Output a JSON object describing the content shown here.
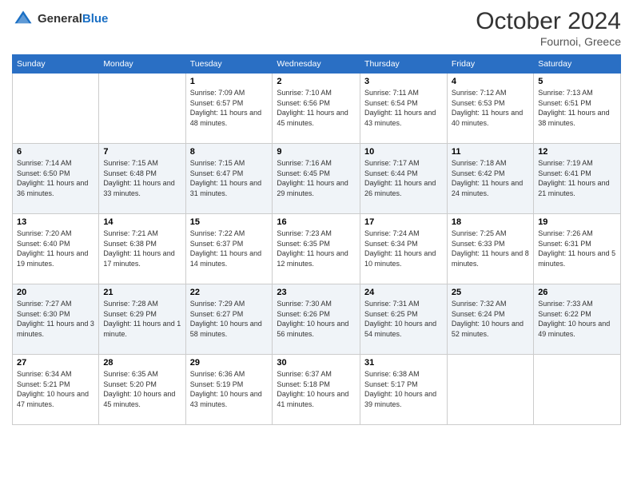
{
  "header": {
    "logo_general": "General",
    "logo_blue": "Blue",
    "month": "October 2024",
    "location": "Fournoi, Greece"
  },
  "weekdays": [
    "Sunday",
    "Monday",
    "Tuesday",
    "Wednesday",
    "Thursday",
    "Friday",
    "Saturday"
  ],
  "weeks": [
    [
      {
        "date": "",
        "info": ""
      },
      {
        "date": "",
        "info": ""
      },
      {
        "date": "1",
        "info": "Sunrise: 7:09 AM\nSunset: 6:57 PM\nDaylight: 11 hours and 48 minutes."
      },
      {
        "date": "2",
        "info": "Sunrise: 7:10 AM\nSunset: 6:56 PM\nDaylight: 11 hours and 45 minutes."
      },
      {
        "date": "3",
        "info": "Sunrise: 7:11 AM\nSunset: 6:54 PM\nDaylight: 11 hours and 43 minutes."
      },
      {
        "date": "4",
        "info": "Sunrise: 7:12 AM\nSunset: 6:53 PM\nDaylight: 11 hours and 40 minutes."
      },
      {
        "date": "5",
        "info": "Sunrise: 7:13 AM\nSunset: 6:51 PM\nDaylight: 11 hours and 38 minutes."
      }
    ],
    [
      {
        "date": "6",
        "info": "Sunrise: 7:14 AM\nSunset: 6:50 PM\nDaylight: 11 hours and 36 minutes."
      },
      {
        "date": "7",
        "info": "Sunrise: 7:15 AM\nSunset: 6:48 PM\nDaylight: 11 hours and 33 minutes."
      },
      {
        "date": "8",
        "info": "Sunrise: 7:15 AM\nSunset: 6:47 PM\nDaylight: 11 hours and 31 minutes."
      },
      {
        "date": "9",
        "info": "Sunrise: 7:16 AM\nSunset: 6:45 PM\nDaylight: 11 hours and 29 minutes."
      },
      {
        "date": "10",
        "info": "Sunrise: 7:17 AM\nSunset: 6:44 PM\nDaylight: 11 hours and 26 minutes."
      },
      {
        "date": "11",
        "info": "Sunrise: 7:18 AM\nSunset: 6:42 PM\nDaylight: 11 hours and 24 minutes."
      },
      {
        "date": "12",
        "info": "Sunrise: 7:19 AM\nSunset: 6:41 PM\nDaylight: 11 hours and 21 minutes."
      }
    ],
    [
      {
        "date": "13",
        "info": "Sunrise: 7:20 AM\nSunset: 6:40 PM\nDaylight: 11 hours and 19 minutes."
      },
      {
        "date": "14",
        "info": "Sunrise: 7:21 AM\nSunset: 6:38 PM\nDaylight: 11 hours and 17 minutes."
      },
      {
        "date": "15",
        "info": "Sunrise: 7:22 AM\nSunset: 6:37 PM\nDaylight: 11 hours and 14 minutes."
      },
      {
        "date": "16",
        "info": "Sunrise: 7:23 AM\nSunset: 6:35 PM\nDaylight: 11 hours and 12 minutes."
      },
      {
        "date": "17",
        "info": "Sunrise: 7:24 AM\nSunset: 6:34 PM\nDaylight: 11 hours and 10 minutes."
      },
      {
        "date": "18",
        "info": "Sunrise: 7:25 AM\nSunset: 6:33 PM\nDaylight: 11 hours and 8 minutes."
      },
      {
        "date": "19",
        "info": "Sunrise: 7:26 AM\nSunset: 6:31 PM\nDaylight: 11 hours and 5 minutes."
      }
    ],
    [
      {
        "date": "20",
        "info": "Sunrise: 7:27 AM\nSunset: 6:30 PM\nDaylight: 11 hours and 3 minutes."
      },
      {
        "date": "21",
        "info": "Sunrise: 7:28 AM\nSunset: 6:29 PM\nDaylight: 11 hours and 1 minute."
      },
      {
        "date": "22",
        "info": "Sunrise: 7:29 AM\nSunset: 6:27 PM\nDaylight: 10 hours and 58 minutes."
      },
      {
        "date": "23",
        "info": "Sunrise: 7:30 AM\nSunset: 6:26 PM\nDaylight: 10 hours and 56 minutes."
      },
      {
        "date": "24",
        "info": "Sunrise: 7:31 AM\nSunset: 6:25 PM\nDaylight: 10 hours and 54 minutes."
      },
      {
        "date": "25",
        "info": "Sunrise: 7:32 AM\nSunset: 6:24 PM\nDaylight: 10 hours and 52 minutes."
      },
      {
        "date": "26",
        "info": "Sunrise: 7:33 AM\nSunset: 6:22 PM\nDaylight: 10 hours and 49 minutes."
      }
    ],
    [
      {
        "date": "27",
        "info": "Sunrise: 6:34 AM\nSunset: 5:21 PM\nDaylight: 10 hours and 47 minutes."
      },
      {
        "date": "28",
        "info": "Sunrise: 6:35 AM\nSunset: 5:20 PM\nDaylight: 10 hours and 45 minutes."
      },
      {
        "date": "29",
        "info": "Sunrise: 6:36 AM\nSunset: 5:19 PM\nDaylight: 10 hours and 43 minutes."
      },
      {
        "date": "30",
        "info": "Sunrise: 6:37 AM\nSunset: 5:18 PM\nDaylight: 10 hours and 41 minutes."
      },
      {
        "date": "31",
        "info": "Sunrise: 6:38 AM\nSunset: 5:17 PM\nDaylight: 10 hours and 39 minutes."
      },
      {
        "date": "",
        "info": ""
      },
      {
        "date": "",
        "info": ""
      }
    ]
  ]
}
